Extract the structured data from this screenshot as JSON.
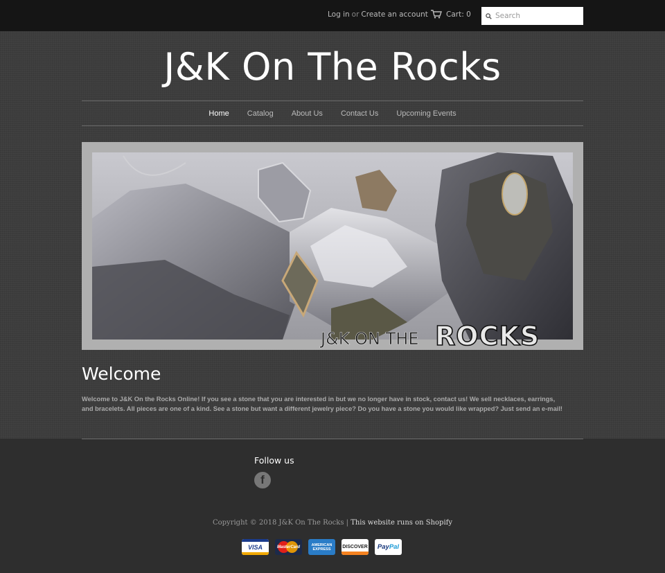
{
  "header": {
    "login_label": "Log in",
    "or_label": "or",
    "create_account_label": "Create an account",
    "cart_label": "Cart: 0",
    "search_placeholder": "Search"
  },
  "site": {
    "title": "J&K On The Rocks"
  },
  "nav": {
    "items": [
      {
        "label": "Home"
      },
      {
        "label": "Catalog"
      },
      {
        "label": "About Us"
      },
      {
        "label": "Contact Us"
      },
      {
        "label": "Upcoming Events"
      }
    ]
  },
  "hero": {
    "logo_text_left": "J&K ON THE",
    "logo_text_right": "ROCKS"
  },
  "welcome": {
    "title": "Welcome",
    "body": "Welcome to J&K On the Rocks Online!  If you see a stone that you are interested in but we no longer have in stock, contact us!  We sell necklaces, earrings, and bracelets.  All pieces are one of a kind. See a stone but want a different jewelry piece?  Do you have a stone you would like wrapped? Just send an e-mail!"
  },
  "footer": {
    "follow_title": "Follow us",
    "facebook_glyph": "f",
    "copyright": "Copyright © 2018 J&K On The Rocks | ",
    "shopify_label": "This website runs on Shopify",
    "payments": {
      "visa": "VISA",
      "mastercard": "MasterCard",
      "amex_line1": "AMERICAN",
      "amex_line2": "EXPRESS",
      "discover": "DISCOVER",
      "paypal_pay": "Pay",
      "paypal_pal": "Pal"
    }
  }
}
